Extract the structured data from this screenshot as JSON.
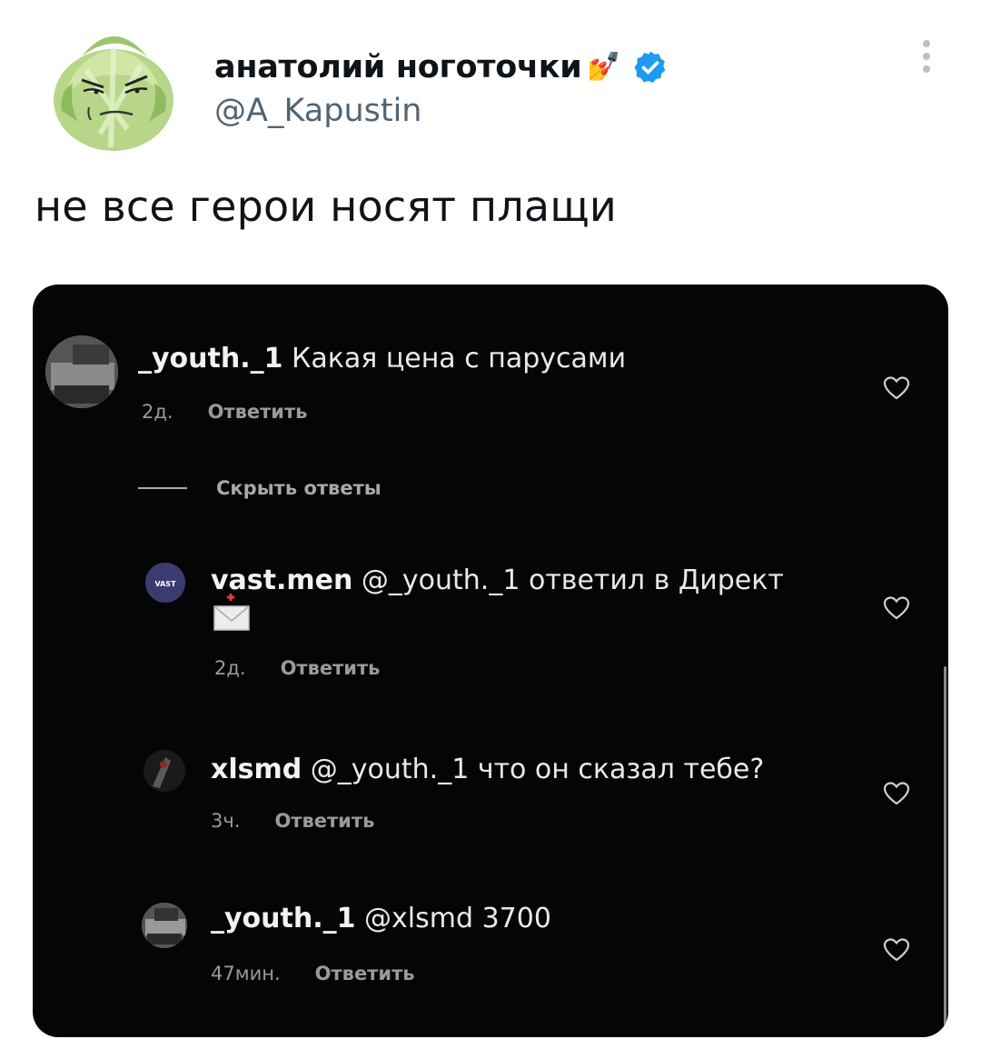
{
  "tweet": {
    "display_name": "анатолий ноготочки",
    "name_emoji": "💅",
    "handle": "@A_Kapustin",
    "text": "не все герои носят плащи"
  },
  "icons": {
    "avatar": "cabbage-face-avatar",
    "verified": "verified-badge-icon",
    "more": "more-vertical-icon",
    "like": "heart-icon",
    "mail": "envelope-icon"
  },
  "colors": {
    "verified": "#1d9bf0",
    "text": "#0f1419",
    "handle": "#536471",
    "media_bg": "#050505"
  },
  "comments": [
    {
      "user": "_youth._1",
      "text": "Какая цена с парусами",
      "time": "2д.",
      "reply": "Ответить"
    },
    {
      "user": "vast.men",
      "text": "@_youth._1 ответил в Директ",
      "time": "2д.",
      "reply": "Ответить",
      "avatar_label": "VAST"
    },
    {
      "user": "xlsmd",
      "text": "@_youth._1 что он сказал тебе?",
      "time": "3ч.",
      "reply": "Ответить"
    },
    {
      "user": "_youth._1",
      "text": "@xlsmd 3700",
      "time": "47мин.",
      "reply": "Ответить"
    }
  ],
  "hide_replies": "Скрыть ответы"
}
